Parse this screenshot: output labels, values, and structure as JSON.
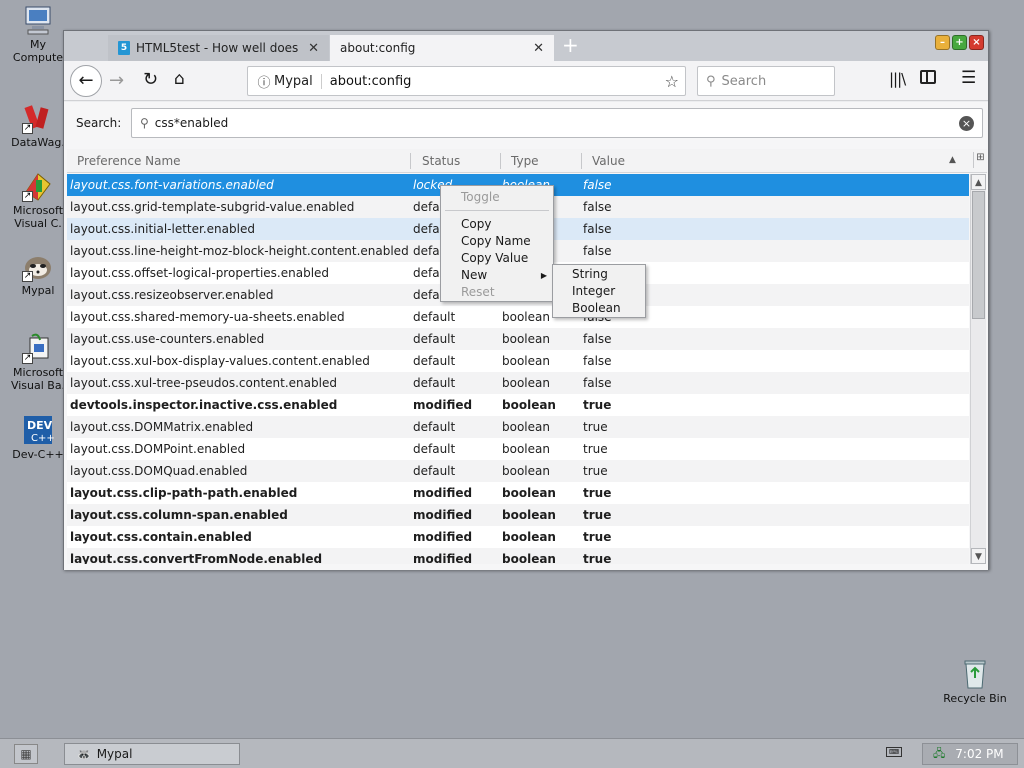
{
  "desktop": {
    "icons": [
      {
        "label": "My Compute",
        "icon": "computer-icon"
      },
      {
        "label": "DataWag.",
        "icon": "datawag-icon"
      },
      {
        "label": "Microsoft Visual C.",
        "icon": "visual-c-icon"
      },
      {
        "label": "Mypal",
        "icon": "mypal-icon"
      },
      {
        "label": "Microsoft Visual Ba.",
        "icon": "visual-basic-icon"
      },
      {
        "label": "Dev-C++",
        "icon": "devcpp-icon"
      },
      {
        "label": "Recycle Bin",
        "icon": "recycle-bin-icon"
      }
    ]
  },
  "browser": {
    "tabs": [
      {
        "title": "HTML5test - How well does",
        "active": false,
        "icon": "html5-icon"
      },
      {
        "title": "about:config",
        "active": true
      }
    ],
    "new_tab": "+",
    "window_buttons": {
      "minimize": "–",
      "maximize": "+",
      "close": "×"
    },
    "url": {
      "site": "Mypal",
      "text": "about:config"
    },
    "search_placeholder": "Search"
  },
  "config": {
    "search_label": "Search:",
    "search_value": "css*enabled",
    "columns": {
      "name": "Preference Name",
      "status": "Status",
      "type": "Type",
      "value": "Value"
    },
    "rows": [
      {
        "name": "layout.css.font-variations.enabled",
        "status": "locked",
        "type": "boolean",
        "value": "false",
        "state": "selected"
      },
      {
        "name": "layout.css.grid-template-subgrid-value.enabled",
        "status": "default",
        "type": "boolean",
        "value": "false"
      },
      {
        "name": "layout.css.initial-letter.enabled",
        "status": "default",
        "type": "boolean",
        "value": "false",
        "state": "hover"
      },
      {
        "name": "layout.css.line-height-moz-block-height.content.enabled",
        "status": "default",
        "type": "boolean",
        "value": "false"
      },
      {
        "name": "layout.css.offset-logical-properties.enabled",
        "status": "default",
        "type": "boolean",
        "value": "false"
      },
      {
        "name": "layout.css.resizeobserver.enabled",
        "status": "default",
        "type": "boolean",
        "value": "false"
      },
      {
        "name": "layout.css.shared-memory-ua-sheets.enabled",
        "status": "default",
        "type": "boolean",
        "value": "false"
      },
      {
        "name": "layout.css.use-counters.enabled",
        "status": "default",
        "type": "boolean",
        "value": "false"
      },
      {
        "name": "layout.css.xul-box-display-values.content.enabled",
        "status": "default",
        "type": "boolean",
        "value": "false"
      },
      {
        "name": "layout.css.xul-tree-pseudos.content.enabled",
        "status": "default",
        "type": "boolean",
        "value": "false"
      },
      {
        "name": "devtools.inspector.inactive.css.enabled",
        "status": "modified",
        "type": "boolean",
        "value": "true",
        "bold": true
      },
      {
        "name": "layout.css.DOMMatrix.enabled",
        "status": "default",
        "type": "boolean",
        "value": "true"
      },
      {
        "name": "layout.css.DOMPoint.enabled",
        "status": "default",
        "type": "boolean",
        "value": "true"
      },
      {
        "name": "layout.css.DOMQuad.enabled",
        "status": "default",
        "type": "boolean",
        "value": "true"
      },
      {
        "name": "layout.css.clip-path-path.enabled",
        "status": "modified",
        "type": "boolean",
        "value": "true",
        "bold": true
      },
      {
        "name": "layout.css.column-span.enabled",
        "status": "modified",
        "type": "boolean",
        "value": "true",
        "bold": true
      },
      {
        "name": "layout.css.contain.enabled",
        "status": "modified",
        "type": "boolean",
        "value": "true",
        "bold": true
      },
      {
        "name": "layout.css.convertFromNode.enabled",
        "status": "modified",
        "type": "boolean",
        "value": "true",
        "bold": true
      }
    ]
  },
  "context_menu": {
    "items": [
      "Toggle",
      "Copy",
      "Copy Name",
      "Copy Value",
      "New",
      "Reset"
    ],
    "submenu": [
      "String",
      "Integer",
      "Boolean"
    ]
  },
  "taskbar": {
    "app": "Mypal",
    "time": "7:02 PM"
  }
}
